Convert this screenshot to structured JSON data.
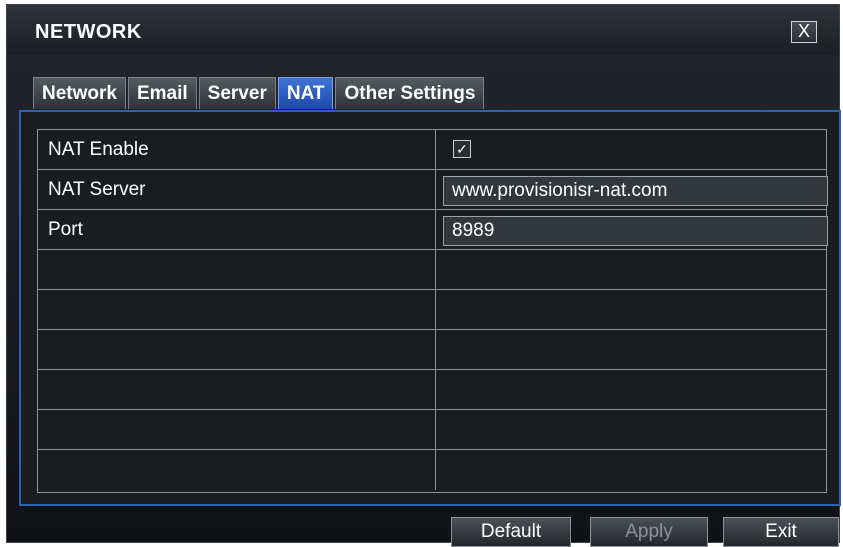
{
  "window": {
    "title": "NETWORK",
    "close_label": "X"
  },
  "tabs": [
    {
      "label": "Network"
    },
    {
      "label": "Email"
    },
    {
      "label": "Server"
    },
    {
      "label": "NAT"
    },
    {
      "label": "Other Settings"
    }
  ],
  "active_tab": "NAT",
  "nat": {
    "enable_label": "NAT Enable",
    "enable_checked": true,
    "check_mark": "✓",
    "server_label": "NAT Server",
    "server_value": "www.provisionisr-nat.com",
    "port_label": "Port",
    "port_value": "8989"
  },
  "buttons": {
    "default_label": "Default",
    "apply_label": "Apply",
    "exit_label": "Exit"
  }
}
